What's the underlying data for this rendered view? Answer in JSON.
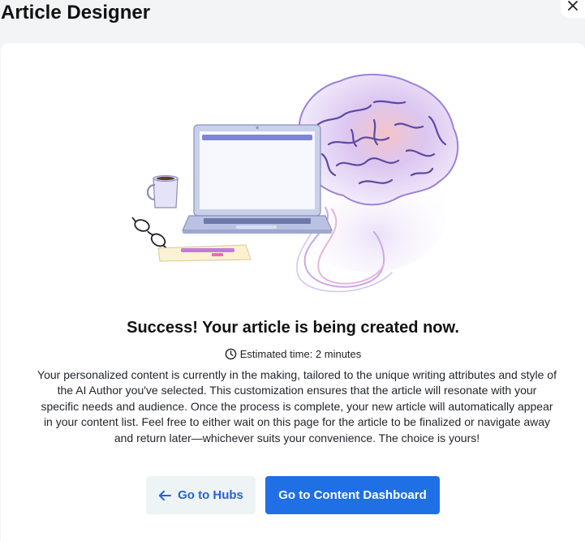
{
  "window": {
    "title": "Article Designer",
    "close_icon": "close-icon"
  },
  "success": {
    "headline": "Success! Your article is being created now.",
    "estimated_time": "Estimated time: 2 minutes",
    "description": "Your personalized content is currently in the making, tailored to the unique writing attributes and style of the AI Author you've selected. This customization ensures that the article will resonate with your specific needs and audience. Once the process is complete, your new article will automatically appear in your content list. Feel free to either wait on this page for the article to be finalized or navigate away and return later—whichever suits your convenience. The choice is yours!"
  },
  "actions": {
    "back_label": "Go to Hubs",
    "primary_label": "Go to Content Dashboard"
  },
  "colors": {
    "primary": "#1f6fe5",
    "secondary_bg": "#eef3f6",
    "secondary_text": "#2563d6",
    "page_bg": "#f3f4f6"
  }
}
